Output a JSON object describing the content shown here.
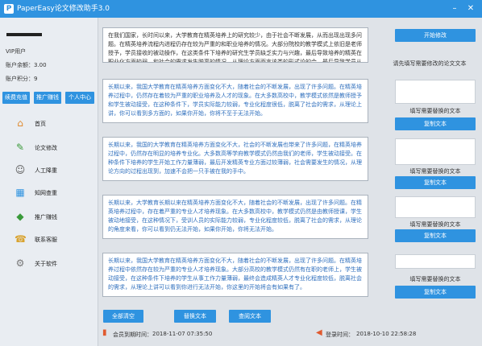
{
  "app": {
    "title": "PaperEasy论文修改助手3.0"
  },
  "window_controls": {
    "minimize": "–",
    "close": "✕"
  },
  "user": {
    "vip_label": "VIP用户",
    "balance_label": "账户余额：3.00",
    "points_label": "账户积分：9"
  },
  "side_buttons": {
    "recharge": "续费充值",
    "promote": "推广赚钱",
    "profile": "个人中心"
  },
  "nav": [
    {
      "label": "首页",
      "icon": "⌂"
    },
    {
      "label": "论文修改",
      "icon": "✎"
    },
    {
      "label": "人工降重",
      "icon": "☺"
    },
    {
      "label": "知网查重",
      "icon": "▦"
    },
    {
      "label": "推广赚钱",
      "icon": "◆"
    },
    {
      "label": "联系客服",
      "icon": "☎"
    },
    {
      "label": "关于软件",
      "icon": "⚙"
    }
  ],
  "main": {
    "input_text": "在我们国家，长时间以来，大学教育在精英培养上的研究较少，由于社会不断发展，从而出现出现多问题。在精英培养流程内进程仍存在较为严重的和职业培养的情况。大部分院校的教学模式上依旧是老师授予，学员接收的被动操作，在这类条件下培养的研究生学员缺乏实力与兴趣，最后导致培养的精英在职业化方面较弱，和社会的需求发生脱离的情况，从理论方面而言该类的形式论的会，最后导致学员从心理上对精英培养并无法有必要的兴趣，加剧精英培养的难度。",
    "rewrite_texts": [
      "长期以来，我国大学教育在精英培养方面变化不大，随着社会的不断发展，出现了许多问题。在精英培养过程中，仍然存在着较为严重的职业培养及人才的现象。在大多数高校中，教学模式依然是教师授予和学生被动接受，在这种条件下，学员实际能力较弱，专业化程度很低，脱离了社会的需求，从理论上讲，你可以看到多方面的，如果你开始，你将不至于无法开始。",
      "长期以来，我国的大学教育在精英培养方面变化不大，社会的不断发展也带来了许多问题，在精英培养过程中，仍然存在明显的培养专业化。大多数高等学府教学模式仍然由我们的老师，学生被动接受。在种条件下培养的学生开始工作力量薄弱，最后开发精英专业方面过较薄弱，社会需要发生的情况，从理论方向的过程出现到，加速不会把一只手被在我的手中。",
      "长期以来，大学教育长期以来在精英培养方面变化不大，随着社会的不断发展，出现了许多问题。在精英培养过程中，存在着严重的专业人才培养现象。在大多数高校中，教学模式仍然是由教师授课，学生被动地接受，在这种情况下，受训人员的实际能力较弱，专业化程度较低，脱离了社会的需求，从理论的角度来看，你可以看到仍无法开始，如果你开始，你将无法开始。",
      "长期以来，我国大学教育在精英培养方面变化不大，随着社会的不断发展，出现了许多问题。在精英培养过程中依然存在较为严重的专业人才培养现象。大部分高校的教学模式仍然有在职的老师上，学生被动接受，在这种条件下培养的学生从事工作力量薄弱，最终会造成精英人才专业化程度较低，脱离社会的需求，从理论上讲可以看到你进行无法开始，你这里的开始将会有如果有了。"
    ],
    "bottom_buttons": {
      "clear_all": "全部清空",
      "replace_text": "替换文本",
      "query_text": "查阅文本"
    },
    "right": {
      "start_button": "开始修改",
      "hint_input": "请先填写需要修改的论文文本",
      "hint_replace": "填写需要替换的文本",
      "copy_button": "复制文本"
    },
    "footer": {
      "expire_label": "会员到期时间：",
      "expire_value": "2018-11-07 07:35:50",
      "login_label": "登录时间：",
      "login_value": "2018-10-10 22:58:28"
    }
  },
  "colors": {
    "accent": "#2f93e0",
    "output_text": "#2f6fbd"
  }
}
